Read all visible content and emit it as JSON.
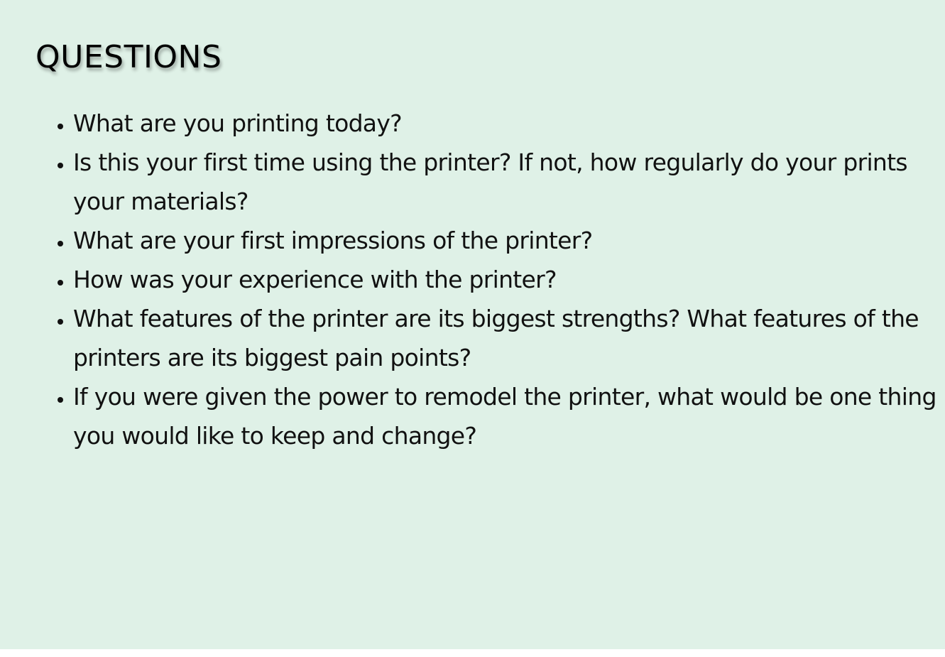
{
  "heading": "QUESTIONS",
  "questions": [
    "What are you printing today?",
    "Is this your first time using the printer? If not, how regularly do your prints your materials?",
    "What are your first impressions of the printer?",
    "How was your experience with the printer?",
    "What features of the printer are its biggest strengths? What features of the printers are its biggest pain points?",
    "If you were given the power to remodel the printer, what would be one thing you would like to keep and change?"
  ],
  "colors": {
    "background": "#dff1e7",
    "text": "#111111"
  }
}
